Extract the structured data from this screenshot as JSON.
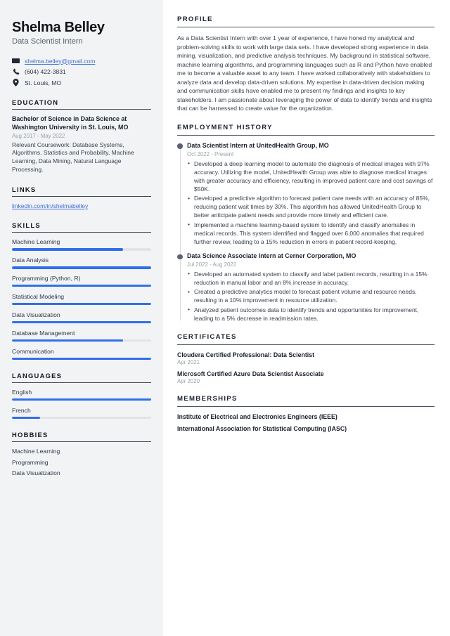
{
  "sidebar": {
    "name": "Shelma Belley",
    "job_title": "Data Scientist Intern",
    "contact": {
      "email": "shelma.belley@gmail.com",
      "phone": "(604) 422-3831",
      "location": "St. Louis, MO"
    },
    "education": {
      "heading": "EDUCATION",
      "entries": [
        {
          "title": "Bachelor of Science in Data Science at Washington University in St. Louis, MO",
          "date": "Aug 2017 - May 2022",
          "description": "Relevant Coursework: Database Systems, Algorithms, Statistics and Probability, Machine Learning, Data Mining, Natural Language Processing."
        }
      ]
    },
    "links": {
      "heading": "LINKS",
      "items": [
        {
          "label": "linkedin.com/in/shelmabelley"
        }
      ]
    },
    "skills": {
      "heading": "SKILLS",
      "items": [
        {
          "label": "Machine Learning",
          "level": 80
        },
        {
          "label": "Data Analysis",
          "level": 100
        },
        {
          "label": "Programming (Python, R)",
          "level": 100
        },
        {
          "label": "Statistical Modeling",
          "level": 100
        },
        {
          "label": "Data Visualization",
          "level": 100
        },
        {
          "label": "Database Management",
          "level": 80
        },
        {
          "label": "Communication",
          "level": 100
        }
      ]
    },
    "languages": {
      "heading": "LANGUAGES",
      "items": [
        {
          "label": "English",
          "level": 100
        },
        {
          "label": "French",
          "level": 20
        }
      ]
    },
    "hobbies": {
      "heading": "HOBBIES",
      "items": [
        {
          "label": "Machine Learning"
        },
        {
          "label": "Programming"
        },
        {
          "label": "Data Visualization"
        }
      ]
    }
  },
  "main": {
    "profile": {
      "heading": "PROFILE",
      "text": "As a Data Scientist Intern with over 1 year of experience, I have honed my analytical and problem-solving skills to work with large data sets. I have developed strong experience in data mining, visualization, and predictive analysis techniques. My background in statistical software, machine learning algorithms, and programming languages such as R and Python have enabled me to become a valuable asset to any team. I have worked collaboratively with stakeholders to analyze data and develop data-driven solutions. My expertise in data-driven decision making and communication skills have enabled me to present my findings and insights to key stakeholders. I am passionate about leveraging the power of data to identify trends and insights that can be harnessed to create value for the organization."
    },
    "employment": {
      "heading": "EMPLOYMENT HISTORY",
      "jobs": [
        {
          "title": "Data Scientist Intern at UnitedHealth Group, MO",
          "date": "Oct 2022 - Present",
          "bullets": [
            "Developed a deep learning model to automate the diagnosis of medical images with 97% accuracy. Utilizing the model, UnitedHealth Group was able to diagnose medical images with greater accuracy and efficiency, resulting in improved patient care and cost savings of $50K.",
            "Developed a predictive algorithm to forecast patient care needs with an accuracy of 85%, reducing patient wait times by 30%. This algorithm has allowed UnitedHealth Group to better anticipate patient needs and provide more timely and efficient care.",
            "Implemented a machine learning-based system to identify and classify anomalies in medical records. This system identified and flagged over 6,000 anomalies that required further review, leading to a 15% reduction in errors in patient record-keeping."
          ]
        },
        {
          "title": "Data Science Associate Intern at Cerner Corporation, MO",
          "date": "Jul 2022 - Aug 2022",
          "bullets": [
            "Developed an automated system to classify and label patient records, resulting in a 15% reduction in manual labor and an 8% increase in accuracy.",
            "Created a predictive analytics model to forecast patient volume and resource needs, resulting in a 10% improvement in resource utilization.",
            "Analyzed patient outcomes data to identify trends and opportunities for improvement, leading to a 5% decrease in readmission rates."
          ]
        }
      ]
    },
    "certificates": {
      "heading": "CERTIFICATES",
      "items": [
        {
          "title": "Cloudera Certified Professional: Data Scientist",
          "date": "Apr 2021"
        },
        {
          "title": "Microsoft Certified Azure Data Scientist Associate",
          "date": "Apr 2020"
        }
      ]
    },
    "memberships": {
      "heading": "MEMBERSHIPS",
      "items": [
        {
          "title": "Institute of Electrical and Electronics Engineers (IEEE)"
        },
        {
          "title": "International Association for Statistical Computing (IASC)"
        }
      ]
    }
  },
  "theme": {
    "accent": "#2f6fed",
    "link": "#3d6fd6",
    "sidebar_bg": "#f2f3f5",
    "heading": "#13151a"
  }
}
